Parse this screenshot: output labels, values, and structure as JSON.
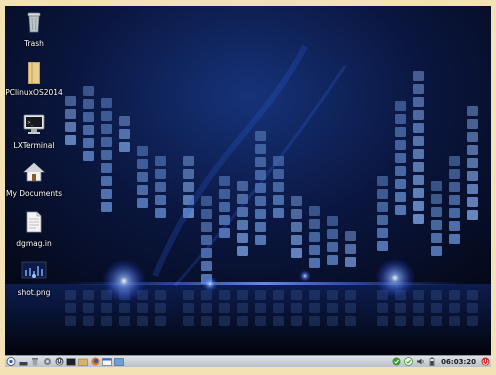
{
  "desktop": {
    "icons": [
      {
        "label": "Trash",
        "icon": "trash-icon"
      },
      {
        "label": "PClinuxOS2014",
        "icon": "folder-icon"
      },
      {
        "label": "LXTerminal",
        "icon": "terminal-icon"
      },
      {
        "label": "My Documents",
        "icon": "home-icon"
      },
      {
        "label": "dgmag.in",
        "icon": "text-file-icon"
      },
      {
        "label": "shot.png",
        "icon": "image-icon"
      }
    ]
  },
  "taskbar": {
    "launchers": [
      "start-menu-icon",
      "show-desktop-icon",
      "trash-icon",
      "settings-icon",
      "power-icon",
      "terminal-icon",
      "file-manager-icon",
      "firefox-icon",
      "window-icon",
      "app-icon"
    ],
    "tray": [
      "update-check-icon",
      "network-check-icon",
      "volume-icon",
      "battery-icon"
    ],
    "clock": "06:03:20",
    "exit_icon": "logout-icon"
  },
  "colors": {
    "frame": "#f3e2b4",
    "desktop_bg": "#050714",
    "tile_blue": "#5f86c8",
    "glow": "#6f9dff",
    "taskbar": "#cfd5dc",
    "clock_text": "#1a1a1a"
  }
}
